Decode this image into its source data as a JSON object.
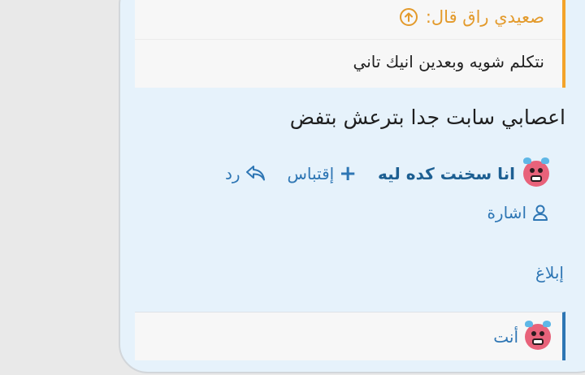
{
  "quote": {
    "author": "صعيدي راق قال:",
    "text": "نتكلم شويه وبعدين انيك تاني",
    "up_icon": "arrow-up-circle-icon",
    "border_color": "#f3a42a"
  },
  "post": {
    "text": "اعصابي سابت جدا بترعش بتفض"
  },
  "actions": {
    "reaction_label": "انا سخنت كده ليه",
    "quote_label": "إقتباس",
    "reply_label": "رد",
    "mention_label": "اشارة",
    "report_label": "إبلاغ"
  },
  "reactions_bar": {
    "label": "أنت",
    "border_color": "#2e76b4"
  },
  "colors": {
    "link": "#2e76b4",
    "quote_author": "#e39a2b",
    "card_bg": "#e6f2fb"
  }
}
